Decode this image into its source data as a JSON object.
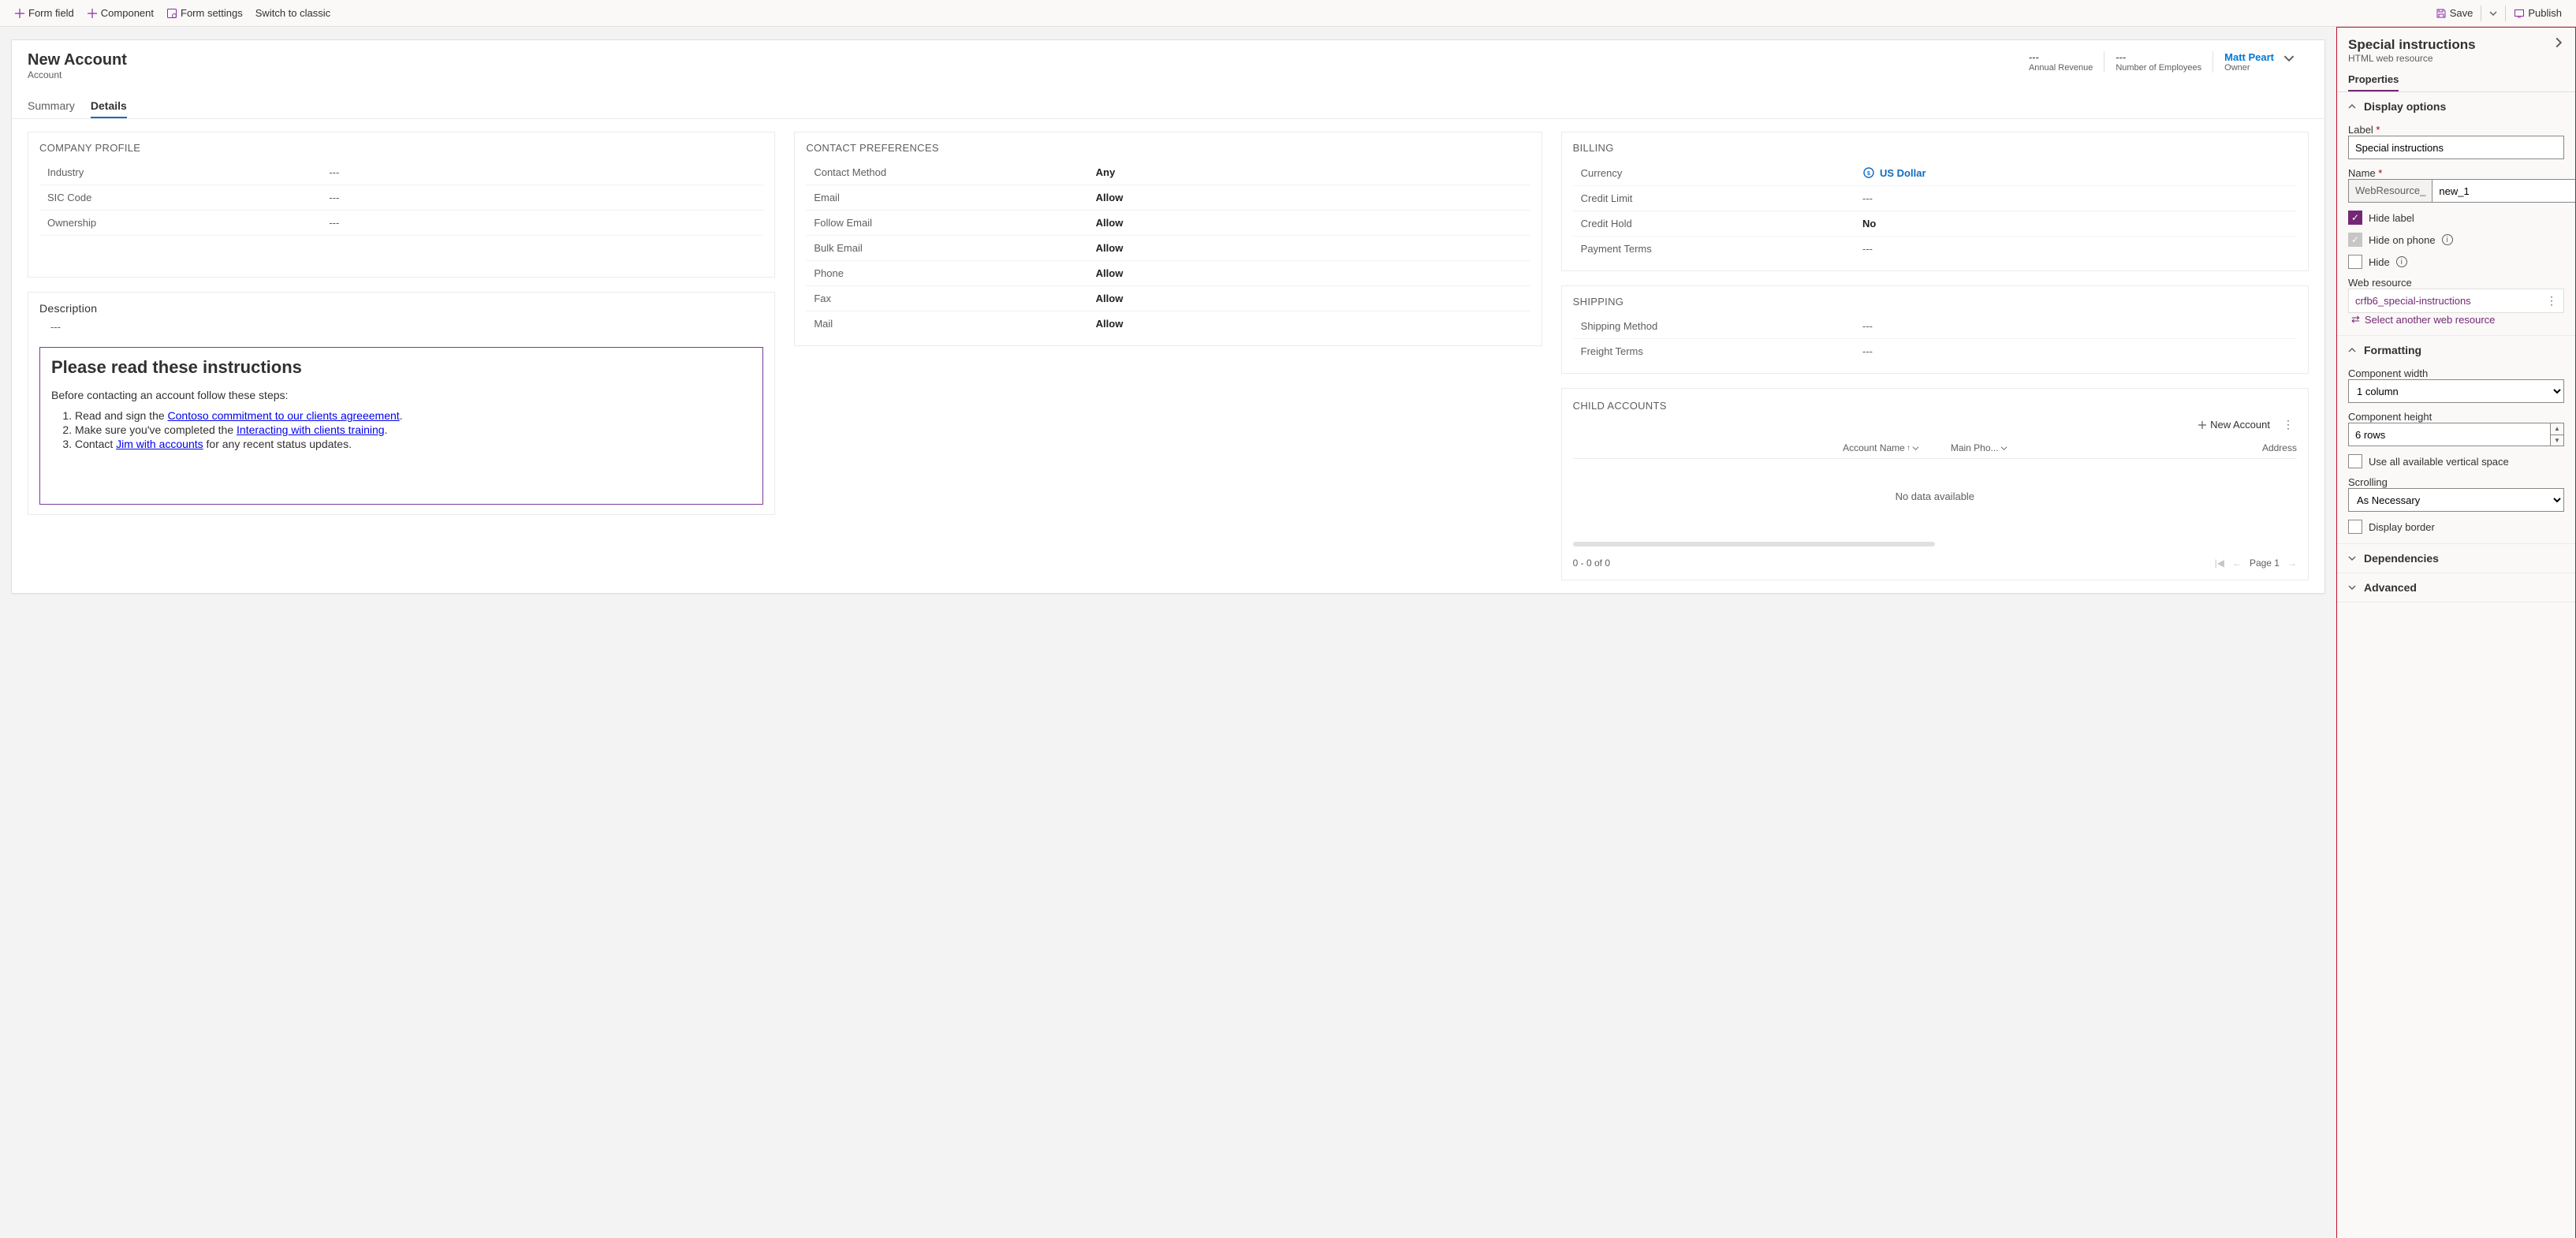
{
  "topbar": {
    "form_field": "Form field",
    "component": "Component",
    "form_settings": "Form settings",
    "switch_classic": "Switch to classic",
    "save": "Save",
    "publish": "Publish"
  },
  "record": {
    "title": "New Account",
    "entity": "Account",
    "header_stats": [
      {
        "value": "---",
        "label": "Annual Revenue"
      },
      {
        "value": "---",
        "label": "Number of Employees"
      }
    ],
    "owner": {
      "value": "Matt Peart",
      "label": "Owner"
    },
    "tabs": {
      "summary": "Summary",
      "details": "Details"
    }
  },
  "company_profile": {
    "title": "COMPANY PROFILE",
    "rows": [
      {
        "label": "Industry",
        "value": "---"
      },
      {
        "label": "SIC Code",
        "value": "---"
      },
      {
        "label": "Ownership",
        "value": "---"
      }
    ]
  },
  "description": {
    "title": "Description",
    "value": "---",
    "instructions": {
      "heading": "Please read these instructions",
      "intro": "Before contacting an account follow these steps:",
      "li1_pre": "Read and sign the ",
      "li1_link": "Contoso commitment to our clients agreeement",
      "li1_post": ".",
      "li2_pre": "Make sure you've completed the ",
      "li2_link": "Interacting with clients training",
      "li2_post": ".",
      "li3_pre": "Contact ",
      "li3_link": "Jim with accounts",
      "li3_post": " for any recent status updates."
    }
  },
  "contact_prefs": {
    "title": "CONTACT PREFERENCES",
    "rows": [
      {
        "label": "Contact Method",
        "value": "Any"
      },
      {
        "label": "Email",
        "value": "Allow"
      },
      {
        "label": "Follow Email",
        "value": "Allow"
      },
      {
        "label": "Bulk Email",
        "value": "Allow"
      },
      {
        "label": "Phone",
        "value": "Allow"
      },
      {
        "label": "Fax",
        "value": "Allow"
      },
      {
        "label": "Mail",
        "value": "Allow"
      }
    ]
  },
  "billing": {
    "title": "BILLING",
    "currency_label": "Currency",
    "currency_value": "US Dollar",
    "rows": [
      {
        "label": "Credit Limit",
        "value": "---"
      },
      {
        "label": "Credit Hold",
        "value": "No"
      },
      {
        "label": "Payment Terms",
        "value": "---"
      }
    ]
  },
  "shipping": {
    "title": "SHIPPING",
    "rows": [
      {
        "label": "Shipping Method",
        "value": "---"
      },
      {
        "label": "Freight Terms",
        "value": "---"
      }
    ]
  },
  "child_accounts": {
    "title": "CHILD ACCOUNTS",
    "new_btn": "New Account",
    "cols": {
      "name": "Account Name",
      "phone": "Main Pho...",
      "address": "Address"
    },
    "nodata": "No data available",
    "footer_count": "0 - 0 of 0",
    "footer_page": "Page 1"
  },
  "props": {
    "title": "Special instructions",
    "subtitle": "HTML web resource",
    "tab": "Properties",
    "display": {
      "heading": "Display options",
      "label_lbl": "Label",
      "label_val": "Special instructions",
      "name_lbl": "Name",
      "name_prefix": "WebResource_",
      "name_val": "new_1",
      "hide_label": "Hide label",
      "hide_phone": "Hide on phone",
      "hide": "Hide",
      "wr_lbl": "Web resource",
      "wr_val": "crfb6_special-instructions",
      "wr_select": "Select another web resource"
    },
    "formatting": {
      "heading": "Formatting",
      "width_lbl": "Component width",
      "width_val": "1 column",
      "height_lbl": "Component height",
      "height_val": "6 rows",
      "use_all": "Use all available vertical space",
      "scroll_lbl": "Scrolling",
      "scroll_val": "As Necessary",
      "border": "Display border"
    },
    "dependencies": "Dependencies",
    "advanced": "Advanced"
  }
}
